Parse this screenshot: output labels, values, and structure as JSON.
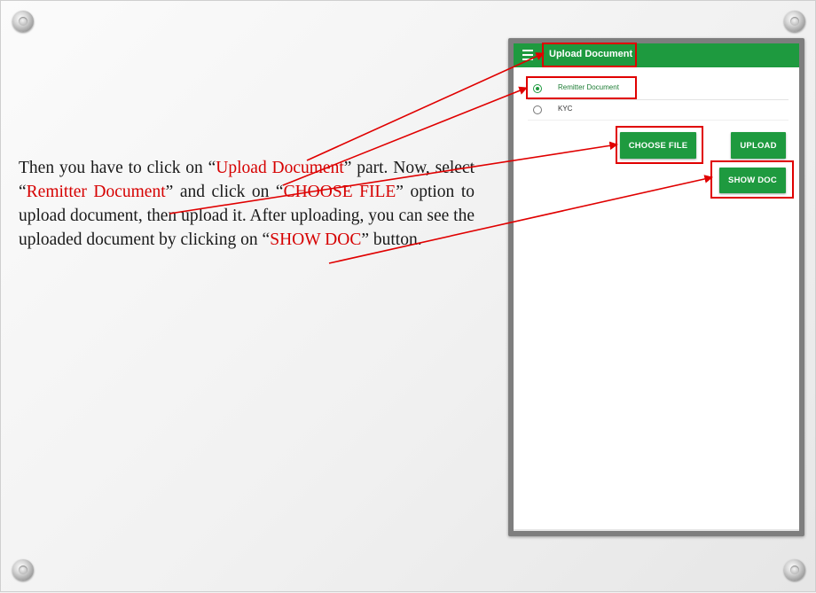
{
  "instructions": {
    "text_1": "Then you have to click on “",
    "highlight_upload_document": "Upload Document",
    "text_2": "” part. Now, select “",
    "highlight_remitter_document": "Remitter Document",
    "text_3": "” and click on “",
    "highlight_choose_file": "CHOOSE FILE",
    "text_4": "” option to upload document, then upload it. After uploading, you can see the uploaded document by clicking on “",
    "highlight_show_doc": "SHOW DOC",
    "text_5": "” button."
  },
  "app": {
    "title": "Upload Document",
    "menu_icon": "hamburger-menu-icon",
    "options": [
      {
        "label": "Remitter Document",
        "selected": true
      },
      {
        "label": "KYC",
        "selected": false
      }
    ],
    "buttons": {
      "choose_file": "CHOOSE FILE",
      "upload": "UPLOAD",
      "show_doc": "SHOW DOC"
    }
  },
  "colors": {
    "app_green": "#1e9a3f",
    "highlight_red": "#d60000",
    "annotation_red": "#e00000"
  }
}
